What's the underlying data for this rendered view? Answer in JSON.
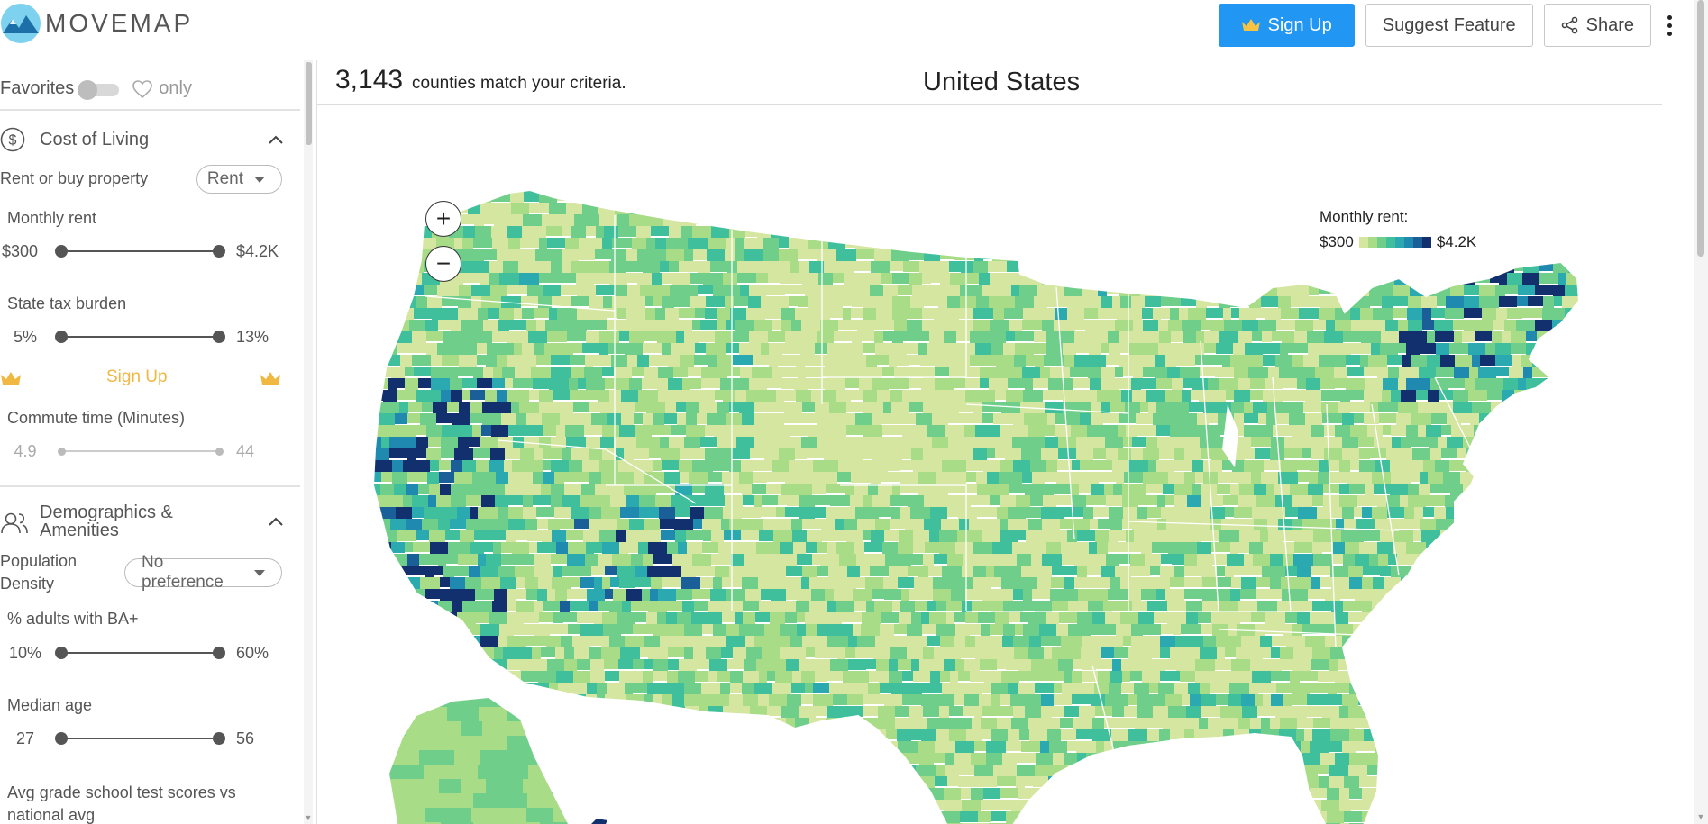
{
  "app": {
    "name": "MOVEMAP"
  },
  "header": {
    "signup_label": "Sign Up",
    "suggest_label": "Suggest Feature",
    "share_label": "Share"
  },
  "sidebar": {
    "favorites": {
      "label": "Favorites",
      "only_label": "only",
      "enabled": false
    },
    "cost_of_living": {
      "title": "Cost of Living",
      "rent_or_buy": {
        "label": "Rent or buy property",
        "value": "Rent"
      },
      "monthly_rent": {
        "label": "Monthly rent",
        "min": "$300",
        "max": "$4.2K"
      },
      "state_tax": {
        "label": "State tax burden",
        "min": "5%",
        "max": "13%"
      },
      "signup_label": "Sign Up",
      "commute": {
        "label": "Commute time (Minutes)",
        "min": "4.9",
        "max": "44"
      }
    },
    "demographics": {
      "title_line1": "Demographics &",
      "title_line2": "Amenities",
      "population_density": {
        "label_line1": "Population",
        "label_line2": "Density",
        "value": "No preference"
      },
      "adults_ba": {
        "label": "% adults with BA+",
        "min": "10%",
        "max": "60%"
      },
      "median_age": {
        "label": "Median age",
        "min": "27",
        "max": "56"
      },
      "test_scores": {
        "label_line1": "Avg grade school test scores vs",
        "label_line2": "national avg"
      }
    }
  },
  "main": {
    "count": "3,143",
    "count_text": "counties match your criteria.",
    "region_title": "United States",
    "zoom_in": "+",
    "zoom_out": "−",
    "legend": {
      "title": "Monthly rent:",
      "min": "$300",
      "max": "$4.2K",
      "colors": [
        "#d4e6a0",
        "#a8dc86",
        "#6fcf8a",
        "#3fbf9b",
        "#2aa9b0",
        "#1f89b0",
        "#1b5f98",
        "#13306e"
      ]
    }
  },
  "colors": {
    "primary": "#2196f3",
    "premium": "#f0b840",
    "map_low": "#d4e6a0",
    "map_high": "#13306e"
  }
}
